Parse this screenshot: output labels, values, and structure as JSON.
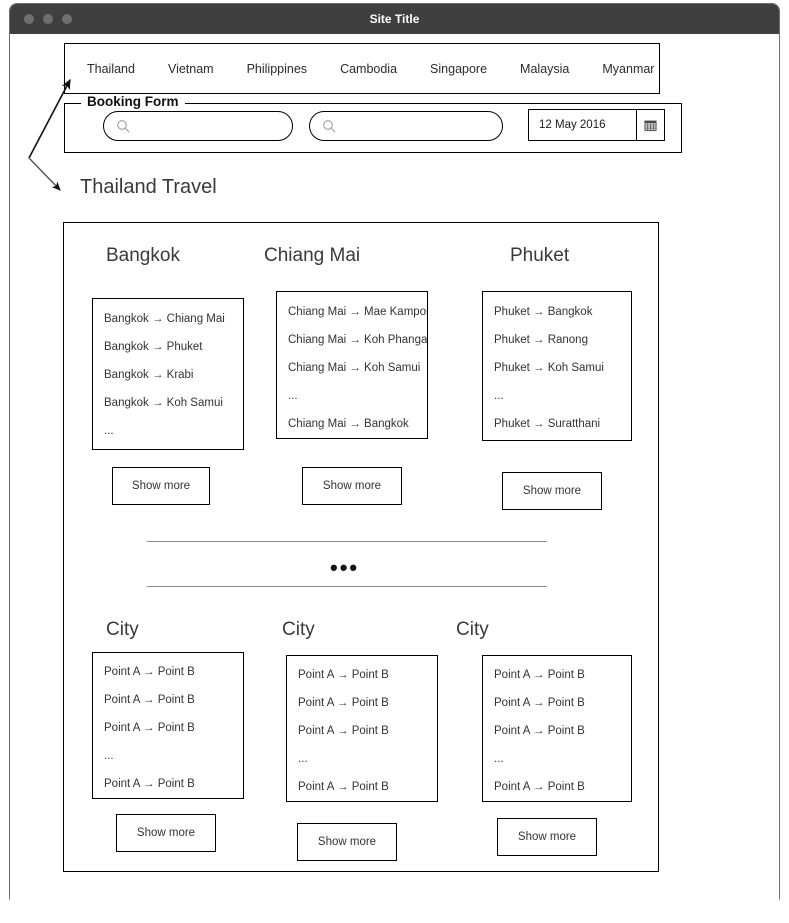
{
  "window": {
    "title": "Site Title",
    "traffic_lights": [
      "close-dot",
      "minimize-dot",
      "maximize-dot"
    ]
  },
  "nav": {
    "items": [
      {
        "label": "Thailand"
      },
      {
        "label": "Vietnam"
      },
      {
        "label": "Philippines"
      },
      {
        "label": "Cambodia"
      },
      {
        "label": "Singapore"
      },
      {
        "label": "Malaysia"
      },
      {
        "label": "Myanmar"
      }
    ]
  },
  "booking_form": {
    "legend": "Booking Form",
    "search_1": {
      "value": "",
      "placeholder": "",
      "icon": "search-icon"
    },
    "search_2": {
      "value": "",
      "placeholder": "",
      "icon": "search-icon"
    },
    "date": {
      "value": "12 May 2016",
      "icon": "calendar-icon"
    }
  },
  "page": {
    "heading": "Thailand Travel"
  },
  "columns_top": [
    {
      "title": "Bangkok",
      "routes": [
        "Bangkok → Chiang Mai",
        "Bangkok → Phuket",
        "Bangkok → Krabi",
        "Bangkok → Koh Samui",
        "..."
      ],
      "button": "Show more"
    },
    {
      "title": "Chiang Mai",
      "routes": [
        "Chiang Mai → Mae Kampong",
        "Chiang Mai → Koh Phangan",
        "Chiang Mai → Koh Samui",
        "...",
        "Chiang Mai → Bangkok"
      ],
      "button": "Show more"
    },
    {
      "title": "Phuket",
      "routes": [
        "Phuket → Bangkok",
        "Phuket →  Ranong",
        "Phuket → Koh Samui",
        "...",
        "Phuket →  Suratthani"
      ],
      "button": "Show more"
    }
  ],
  "divider": {
    "dots": "•••"
  },
  "columns_bottom": [
    {
      "title": "City",
      "routes": [
        "Point A → Point B",
        "Point A → Point B",
        "Point A → Point B",
        "...",
        "Point A → Point B"
      ],
      "button": "Show more"
    },
    {
      "title": "City",
      "routes": [
        "Point A → Point B",
        "Point A → Point B",
        "Point A → Point B",
        "...",
        "Point A → Point B"
      ],
      "button": "Show more"
    },
    {
      "title": "City",
      "routes": [
        "Point A → Point B",
        "Point A → Point B",
        "Point A → Point B",
        "...",
        "Point A → Point B"
      ],
      "button": "Show more"
    }
  ],
  "annotations": {
    "arrow_to_nav": "callout-arrow",
    "arrow_to_heading": "callout-arrow"
  },
  "colors": {
    "titlebar": "#3f3f3f",
    "titlebar_text": "#ffffff",
    "outline": "#000000",
    "text": "#333333",
    "muted_line": "#8c8c8c"
  }
}
